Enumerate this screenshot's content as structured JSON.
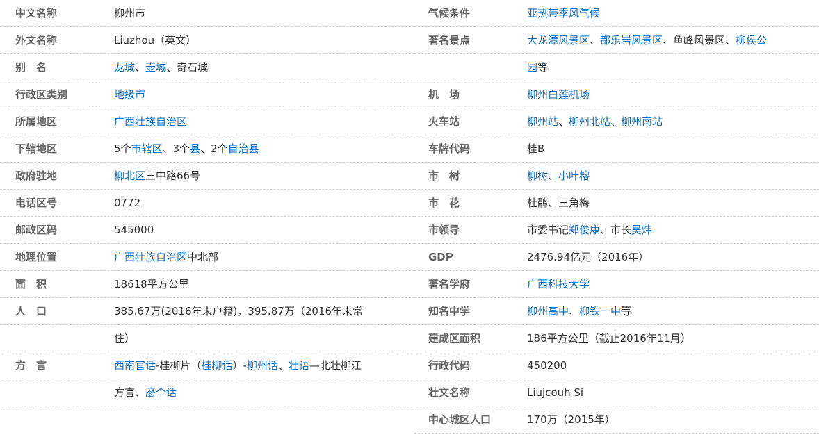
{
  "left": [
    {
      "label": "中文名称",
      "value": [
        {
          "t": "柳州市",
          "link": false
        }
      ]
    },
    {
      "label": "外文名称",
      "value": [
        {
          "t": "Liuzhou（英文）",
          "link": false
        }
      ]
    },
    {
      "label": "别　名",
      "value": [
        {
          "t": "龙城",
          "link": true
        },
        {
          "t": "、",
          "link": false
        },
        {
          "t": "壶城",
          "link": true
        },
        {
          "t": "、奇石城",
          "link": false
        }
      ]
    },
    {
      "label": "行政区类别",
      "value": [
        {
          "t": "地级市",
          "link": true
        }
      ]
    },
    {
      "label": "所属地区",
      "value": [
        {
          "t": "广西壮族自治区",
          "link": true
        }
      ]
    },
    {
      "label": "下辖地区",
      "value": [
        {
          "t": "5个",
          "link": false
        },
        {
          "t": "市辖区",
          "link": true
        },
        {
          "t": "、3个",
          "link": false
        },
        {
          "t": "县",
          "link": true
        },
        {
          "t": "、2个",
          "link": false
        },
        {
          "t": "自治县",
          "link": true
        }
      ]
    },
    {
      "label": "政府驻地",
      "value": [
        {
          "t": "柳北区",
          "link": true
        },
        {
          "t": "三中路66号",
          "link": false
        }
      ]
    },
    {
      "label": "电话区号",
      "value": [
        {
          "t": "0772",
          "link": false
        }
      ]
    },
    {
      "label": "邮政区码",
      "value": [
        {
          "t": "545000",
          "link": false
        }
      ]
    },
    {
      "label": "地理位置",
      "value": [
        {
          "t": "广西壮族自治区",
          "link": true
        },
        {
          "t": "中北部",
          "link": false
        }
      ]
    },
    {
      "label": "面　积",
      "value": [
        {
          "t": "18618平方公里",
          "link": false
        }
      ]
    },
    {
      "label": "人　口",
      "value": [
        {
          "t": "385.67万(2016年末户籍)，395.87万（2016年末常",
          "link": false
        }
      ]
    },
    {
      "label": "",
      "value": [
        {
          "t": "住）",
          "link": false
        }
      ]
    },
    {
      "label": "方　言",
      "value": [
        {
          "t": "西南官话",
          "link": true
        },
        {
          "t": "-桂柳片（",
          "link": false
        },
        {
          "t": "桂柳话",
          "link": true
        },
        {
          "t": "）-",
          "link": false
        },
        {
          "t": "柳州话",
          "link": true
        },
        {
          "t": "、",
          "link": false
        },
        {
          "t": "壮语",
          "link": true
        },
        {
          "t": "—北壮柳江",
          "link": false
        }
      ]
    },
    {
      "label": "",
      "value": [
        {
          "t": "方言、",
          "link": false
        },
        {
          "t": "麽个话",
          "link": true
        }
      ]
    }
  ],
  "right": [
    {
      "label": "气候条件",
      "value": [
        {
          "t": "亚热带季风气候",
          "link": true
        }
      ]
    },
    {
      "label": "著名景点",
      "value": [
        {
          "t": "大龙潭风景区",
          "link": true
        },
        {
          "t": "、",
          "link": false
        },
        {
          "t": "都乐岩风景区",
          "link": true
        },
        {
          "t": "、鱼峰风景区、",
          "link": false
        },
        {
          "t": "柳侯公",
          "link": true
        }
      ]
    },
    {
      "label": "",
      "value": [
        {
          "t": "园",
          "link": true
        },
        {
          "t": "等",
          "link": false
        }
      ]
    },
    {
      "label": "机　场",
      "value": [
        {
          "t": "柳州白莲机场",
          "link": true
        }
      ]
    },
    {
      "label": "火车站",
      "value": [
        {
          "t": "柳州站",
          "link": true
        },
        {
          "t": "、",
          "link": false
        },
        {
          "t": "柳州北站",
          "link": true
        },
        {
          "t": "、",
          "link": false
        },
        {
          "t": "柳州南站",
          "link": true
        }
      ]
    },
    {
      "label": "车牌代码",
      "value": [
        {
          "t": "桂B",
          "link": false
        }
      ]
    },
    {
      "label": "市　树",
      "value": [
        {
          "t": "柳树",
          "link": true
        },
        {
          "t": "、",
          "link": false
        },
        {
          "t": "小叶榕",
          "link": true
        }
      ]
    },
    {
      "label": "市　花",
      "value": [
        {
          "t": "杜鹃、三角梅",
          "link": false
        }
      ]
    },
    {
      "label": "市领导",
      "value": [
        {
          "t": "市委书记",
          "link": false
        },
        {
          "t": "郑俊康",
          "link": true
        },
        {
          "t": "、市长",
          "link": false
        },
        {
          "t": "吴炜",
          "link": true
        }
      ]
    },
    {
      "label": "GDP",
      "value": [
        {
          "t": "2476.94亿元（2016年）",
          "link": false
        }
      ]
    },
    {
      "label": "著名学府",
      "value": [
        {
          "t": "广西科技大学",
          "link": true
        }
      ]
    },
    {
      "label": "知名中学",
      "value": [
        {
          "t": "柳州高中",
          "link": true
        },
        {
          "t": "、",
          "link": false
        },
        {
          "t": "柳铁一中",
          "link": true
        },
        {
          "t": "等",
          "link": false
        }
      ]
    },
    {
      "label": "建成区面积",
      "value": [
        {
          "t": "186平方公里（截止2016年11月）",
          "link": false
        }
      ]
    },
    {
      "label": "行政代码",
      "value": [
        {
          "t": "450200",
          "link": false
        }
      ]
    },
    {
      "label": "壮文名称",
      "value": [
        {
          "t": "Liujcouh Si",
          "link": false
        }
      ]
    },
    {
      "label": "中心城区人口",
      "value": [
        {
          "t": "170万（2015年）",
          "link": false
        }
      ]
    }
  ],
  "colors": {
    "link": "#136ec2",
    "label": "#666666",
    "text": "#333333",
    "divider": "#cfcfcf"
  }
}
